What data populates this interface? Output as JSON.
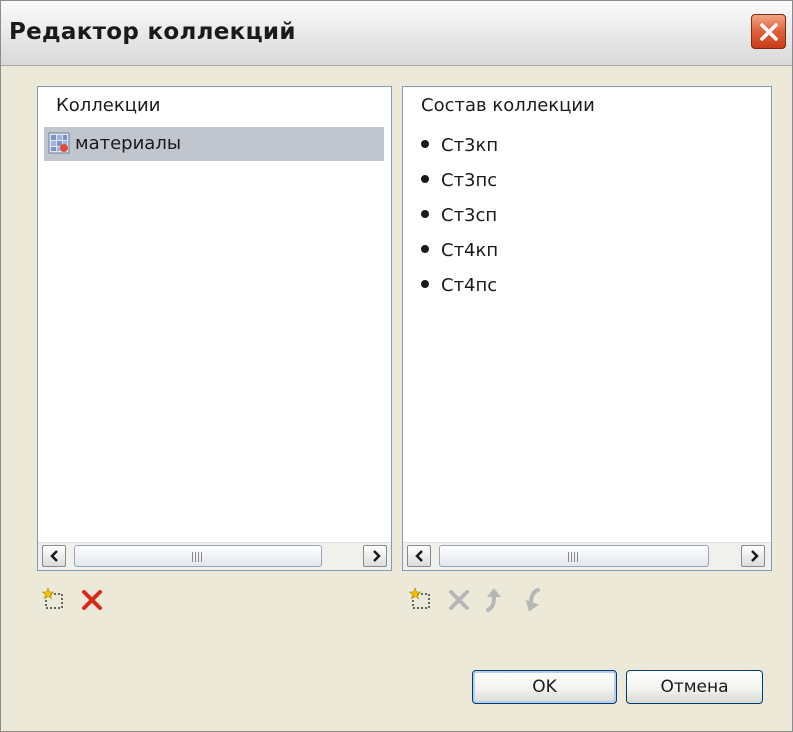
{
  "window": {
    "title": "Редактор коллекций"
  },
  "collections_panel": {
    "header": "Коллекции",
    "items": [
      {
        "label": "материалы",
        "selected": true,
        "icon": "collection-icon"
      }
    ],
    "toolbar": [
      {
        "name": "add-collection-button",
        "icon": "new-item-icon",
        "enabled": true
      },
      {
        "name": "delete-collection-button",
        "icon": "delete-icon",
        "enabled": true
      }
    ]
  },
  "members_panel": {
    "header": "Состав коллекции",
    "items": [
      "Ст3кп",
      "Ст3пс",
      "Ст3сп",
      "Ст4кп",
      "Ст4пс"
    ],
    "toolbar": [
      {
        "name": "add-member-button",
        "icon": "new-item-icon",
        "enabled": true
      },
      {
        "name": "delete-member-button",
        "icon": "delete-icon",
        "enabled": false
      },
      {
        "name": "move-up-button",
        "icon": "arrow-up-icon",
        "enabled": false
      },
      {
        "name": "move-down-button",
        "icon": "arrow-down-icon",
        "enabled": false
      }
    ]
  },
  "buttons": {
    "ok": "OK",
    "cancel": "Отмена"
  },
  "colors": {
    "selection": "#c1c5cd",
    "close_button": "#e0603b",
    "delete_active": "#d42a1e",
    "disabled_icon": "#b7b7b7"
  }
}
